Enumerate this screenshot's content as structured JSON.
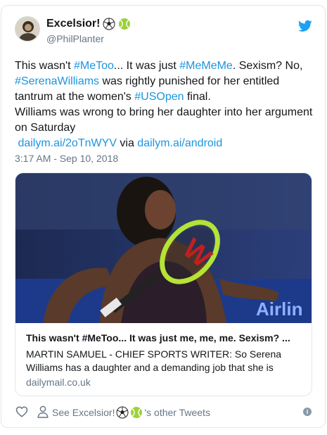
{
  "header": {
    "display_name": "Excelsior!",
    "name_emojis": [
      "soccer-ball-icon",
      "tennis-ball-icon"
    ],
    "handle": "@PhilPlanter",
    "brand_icon": "twitter-bird-icon"
  },
  "tweet": {
    "line1_pre": "This wasn't ",
    "hashtag_metoo": "#MeToo",
    "line1_mid": "... It was just ",
    "hashtag_mememe": "#MeMeMe",
    "line1_post": ". Sexism? No, ",
    "hashtag_serena": "#SerenaWilliams",
    "line2_post": " was rightly punished for her entitled tantrum at the women's ",
    "hashtag_usopen": "#USOpen",
    "line3_post": " final.",
    "paragraph2": "Williams was wrong to bring her daughter into her argument on Saturday",
    "short_link": "dailym.ai/2oTnWYV",
    "via_text": " via ",
    "via_link": "dailym.ai/android",
    "timestamp": "3:17 AM - Sep 10, 2018"
  },
  "link_card": {
    "title": "This wasn't #MeToo... It was just me, me, me. Sexism? ...",
    "description": "MARTIN SAMUEL - CHIEF SPORTS WRITER: So Serena Williams has a daughter and a demanding job that she is",
    "domain": "dailymail.co.uk",
    "image_banner_text": "Airlin"
  },
  "footer": {
    "heart_icon": "heart-icon",
    "person_icon": "person-icon",
    "other_tweets_pre": "See Excelsior! ",
    "other_tweets_post": "'s other Tweets",
    "info_glyph": "i"
  },
  "colors": {
    "link": "#1b95e0",
    "twitter_blue": "#1da1f2",
    "muted": "#657786",
    "border": "#e1e8ed"
  }
}
